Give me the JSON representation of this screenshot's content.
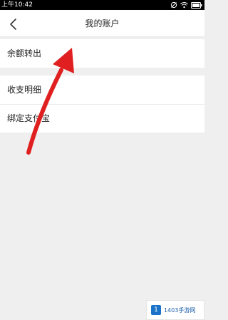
{
  "status_bar": {
    "time": "上午10:42",
    "icons": [
      "dnd-off-icon",
      "wifi-icon",
      "battery-icon"
    ]
  },
  "header": {
    "title": "我的账户",
    "back_icon": "chevron-left-icon"
  },
  "menu": {
    "items": [
      {
        "label": "余额转出"
      },
      {
        "label": "收支明细"
      },
      {
        "label": "绑定支付宝"
      }
    ]
  },
  "annotation": {
    "color": "#e02020"
  },
  "watermark": {
    "text": "1403手游网"
  },
  "colors": {
    "background": "#efefef",
    "surface": "#ffffff",
    "text": "#222222",
    "status_bar": "#000000"
  }
}
